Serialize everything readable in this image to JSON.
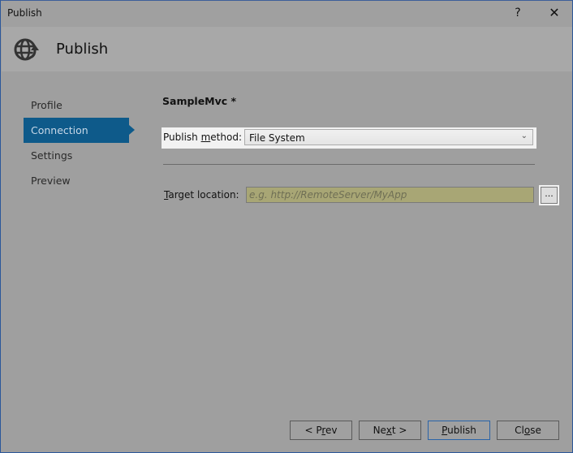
{
  "window": {
    "title": "Publish",
    "help_label": "?",
    "close_label": "✕"
  },
  "header": {
    "icon": "globe-publish-icon",
    "title": "Publish"
  },
  "nav": {
    "items": [
      {
        "label": "Profile",
        "active": false
      },
      {
        "label": "Connection",
        "active": true
      },
      {
        "label": "Settings",
        "active": false
      },
      {
        "label": "Preview",
        "active": false
      }
    ]
  },
  "main": {
    "project_name": "SampleMvc *",
    "publish_method": {
      "label_pre": "Publish ",
      "label_accel": "m",
      "label_post": "ethod:",
      "value": "File System"
    },
    "target_location": {
      "label_accel": "T",
      "label_post": "arget location:",
      "value": "",
      "placeholder": "e.g. http://RemoteServer/MyApp",
      "browse_label": "..."
    }
  },
  "footer": {
    "prev": {
      "pre": "< P",
      "accel": "r",
      "post": "ev"
    },
    "next": {
      "pre": "Ne",
      "accel": "x",
      "post": "t >"
    },
    "publish": {
      "pre": "",
      "accel": "P",
      "post": "ublish"
    },
    "close": {
      "pre": "Cl",
      "accel": "o",
      "post": "se"
    }
  },
  "colors": {
    "accent": "#0e5a8a",
    "window_border": "#2b579a",
    "background": "#9f9f9f",
    "input_highlight": "#a8a675"
  }
}
